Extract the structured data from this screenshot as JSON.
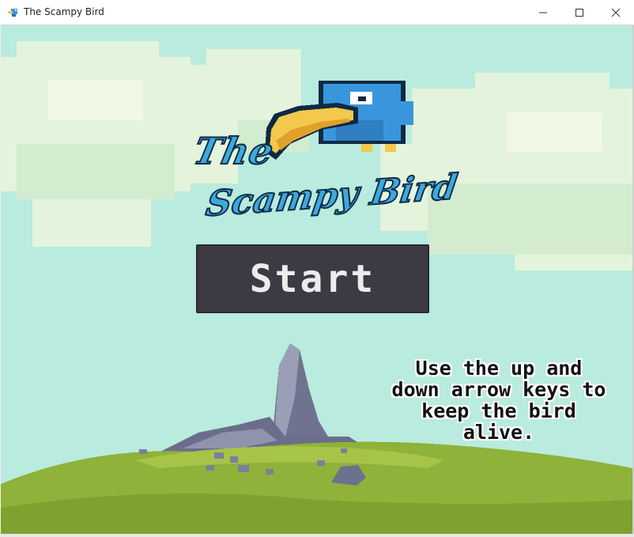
{
  "window": {
    "title": "The Scampy Bird",
    "icon": "bird-app-icon",
    "controls": [
      "minimize",
      "maximize",
      "close"
    ]
  },
  "game": {
    "logo_line1": "The",
    "logo_line2": "Scampy Bird",
    "start_label": "Start",
    "instructions": "Use the up and down arrow keys to keep the bird alive."
  },
  "colors": {
    "sky": "#b9ebde",
    "clouds": "#e4f3dc",
    "grass": "#8fb23a",
    "button": "#3d3a44",
    "bird": "#3a96dc",
    "beak": "#f2c94c"
  }
}
